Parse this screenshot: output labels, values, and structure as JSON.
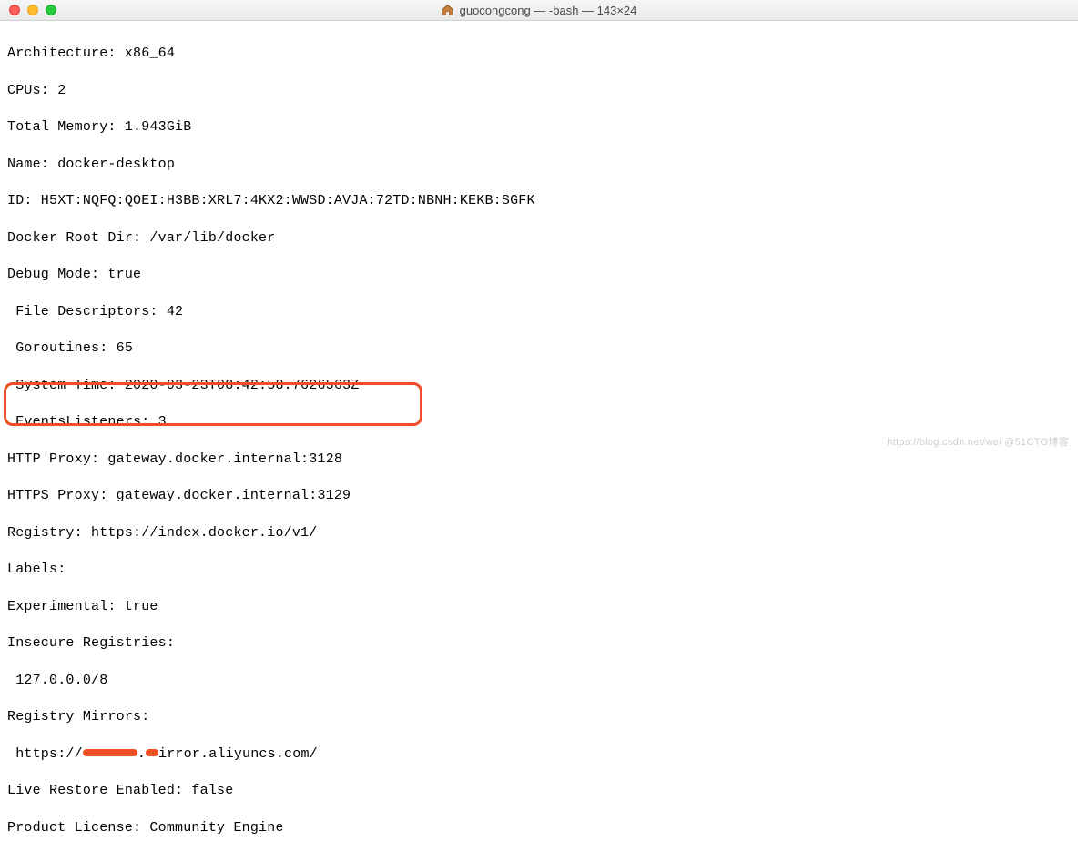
{
  "window": {
    "title": "guocongcong — -bash — 143×24"
  },
  "terminal": {
    "lines": {
      "architecture": "Architecture: x86_64",
      "cpus": "CPUs: 2",
      "total_memory": "Total Memory: 1.943GiB",
      "name": "Name: docker-desktop",
      "id": "ID: H5XT:NQFQ:QOEI:H3BB:XRL7:4KX2:WWSD:AVJA:72TD:NBNH:KEKB:SGFK",
      "docker_root_dir": "Docker Root Dir: /var/lib/docker",
      "debug_mode": "Debug Mode: true",
      "file_descriptors": " File Descriptors: 42",
      "goroutines": " Goroutines: 65",
      "system_time": " System Time: 2020-03-23T08:42:58.7626563Z",
      "events_listeners": " EventsListeners: 3",
      "http_proxy": "HTTP Proxy: gateway.docker.internal:3128",
      "https_proxy": "HTTPS Proxy: gateway.docker.internal:3129",
      "registry": "Registry: https://index.docker.io/v1/",
      "labels": "Labels:",
      "experimental": "Experimental: true",
      "insecure_registries": "Insecure Registries:",
      "insecure_entry": " 127.0.0.0/8",
      "registry_mirrors": "Registry Mirrors:",
      "mirror_prefix": " https://",
      "mirror_mid": ".",
      "mirror_suffix": "irror.aliyuncs.com/",
      "live_restore": "Live Restore Enabled: false",
      "product_license": "Product License: Community Engine"
    }
  },
  "watermark": "https://blog.csdn.net/wei @51CTO博客"
}
